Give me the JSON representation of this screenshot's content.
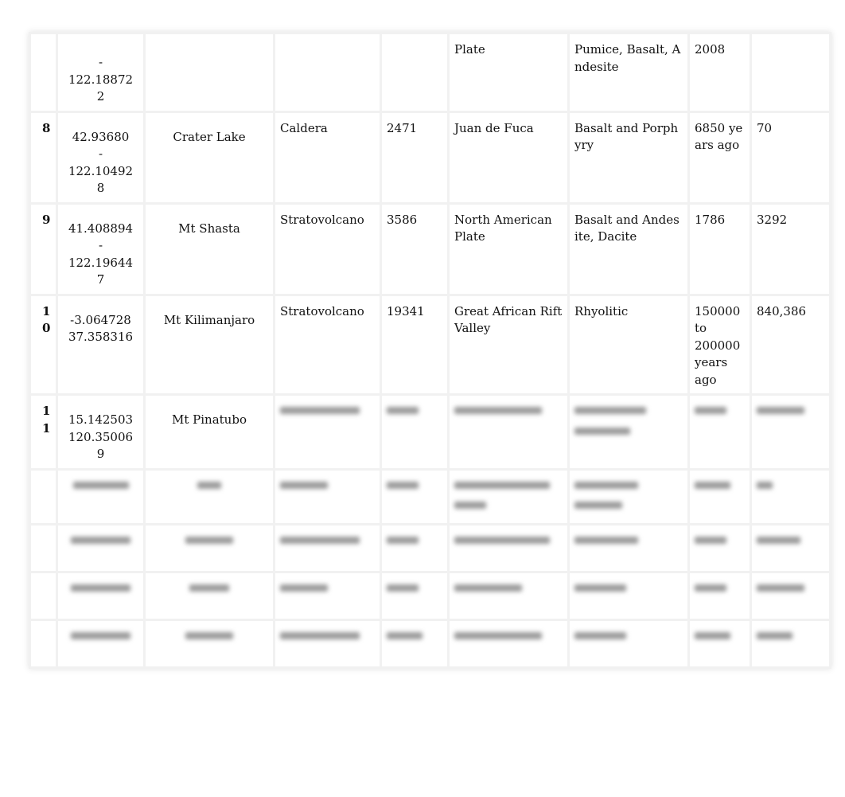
{
  "rows": [
    {
      "num": "",
      "coords": [
        "-",
        "122.18872",
        "2"
      ],
      "name": "",
      "type": "",
      "elevation": "",
      "plate": "Plate",
      "rock": "Pumice, Basalt, Andesite",
      "last_eruption": "2008",
      "extra": ""
    },
    {
      "num": "8",
      "coords": [
        "42.93680",
        "-",
        "122.10492",
        "8"
      ],
      "name": "Crater Lake",
      "type": "Caldera",
      "elevation": "2471",
      "plate": "Juan de Fuca",
      "rock": "Basalt and Porphyry",
      "last_eruption": "6850 years ago",
      "extra": "70"
    },
    {
      "num": "9",
      "coords": [
        "41.408894",
        "-",
        "122.19644",
        "7"
      ],
      "name": "Mt Shasta",
      "type": "Stratovolcano",
      "elevation": "3586",
      "plate": "North American Plate",
      "rock": "Basalt and Andesite, Dacite",
      "last_eruption": "1786",
      "extra": "3292"
    },
    {
      "num": "10",
      "coords": [
        "-3.064728",
        "37.358316"
      ],
      "name": "Mt Kilimanjaro",
      "type": "Stratovolcano",
      "elevation": "19341",
      "plate": "Great African Rift Valley",
      "rock": "Rhyolitic",
      "last_eruption": "150000 to 200000 years ago",
      "extra": "840,386"
    },
    {
      "num": "11",
      "coords": [
        "15.142503",
        "120.35006",
        "9"
      ],
      "name": "Mt Pinatubo"
    }
  ]
}
